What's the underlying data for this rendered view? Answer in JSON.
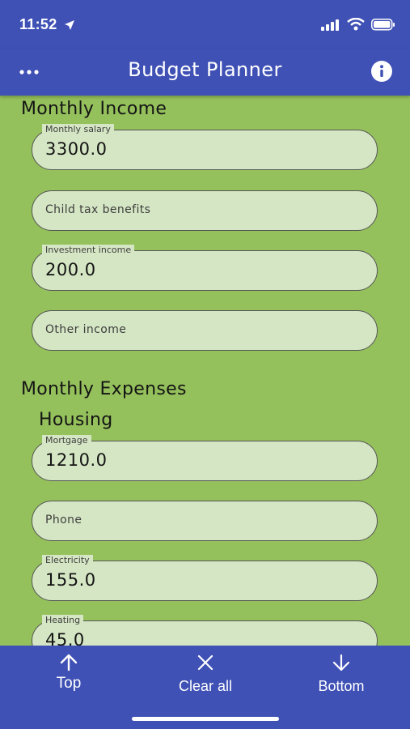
{
  "status_bar": {
    "time": "11:52"
  },
  "app_bar": {
    "title": "Budget Planner",
    "menu_icon": "more-horizontal-icon",
    "info_icon": "info-icon"
  },
  "income": {
    "title": "Monthly Income",
    "fields": [
      {
        "label": "Monthly salary",
        "value": "3300.0"
      },
      {
        "placeholder": "Child tax benefits"
      },
      {
        "label": "Investment income",
        "value": "200.0"
      },
      {
        "placeholder": "Other income"
      }
    ]
  },
  "expenses": {
    "title": "Monthly Expenses",
    "housing": {
      "title": "Housing",
      "fields": [
        {
          "label": "Mortgage",
          "value": "1210.0"
        },
        {
          "placeholder": "Phone"
        },
        {
          "label": "Electricity",
          "value": "155.0"
        },
        {
          "label": "Heating",
          "value": "45.0"
        }
      ]
    }
  },
  "bottom_bar": {
    "top_label": "Top",
    "clear_label": "Clear all",
    "bottom_label": "Bottom"
  },
  "colors": {
    "primary": "#3f51b5",
    "background": "#95c15c",
    "field": "#d5e6c4"
  }
}
